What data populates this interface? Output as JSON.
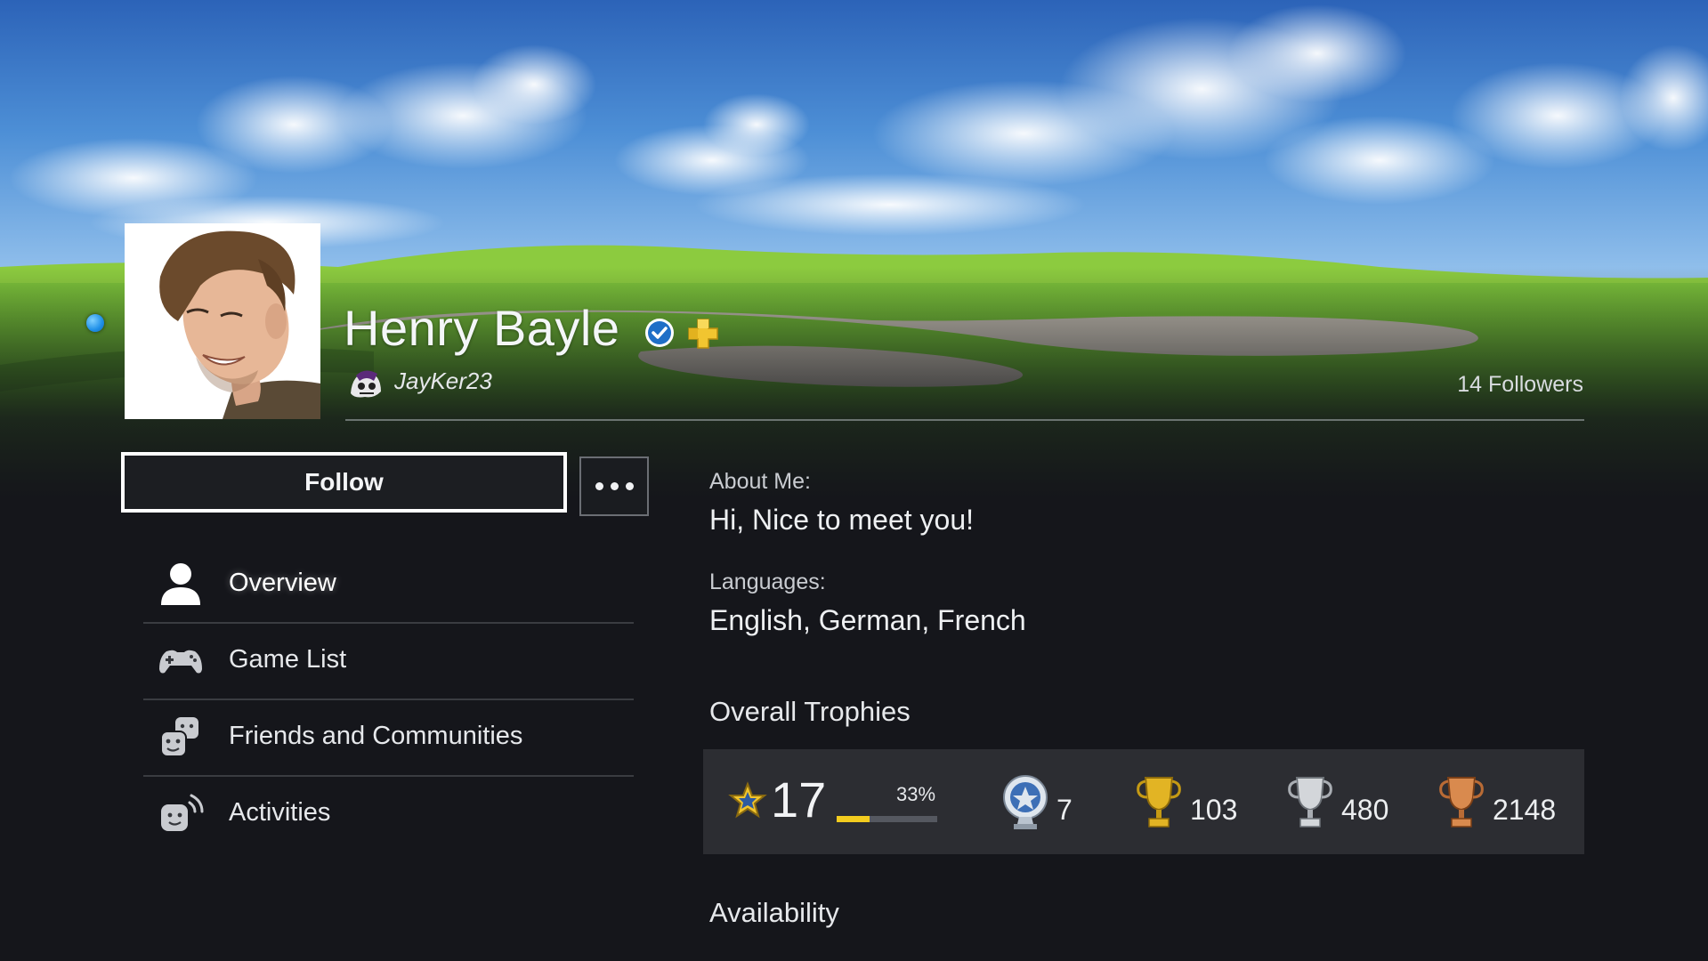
{
  "profile": {
    "display_name": "Henry Bayle",
    "online_id": "JayKer23",
    "followers": "14 Followers",
    "online_status_color": "#1e8fe8"
  },
  "actions": {
    "follow_label": "Follow",
    "more_icon": "ellipsis-icon"
  },
  "nav": {
    "items": [
      {
        "label": "Overview",
        "icon": "person-icon"
      },
      {
        "label": "Game List",
        "icon": "gamepad-icon"
      },
      {
        "label": "Friends and Communities",
        "icon": "friends-icon"
      },
      {
        "label": "Activities",
        "icon": "activity-icon"
      }
    ]
  },
  "about": {
    "label": "About Me:",
    "text": "Hi, Nice to meet you!"
  },
  "languages": {
    "label": "Languages:",
    "text": "English, German, French"
  },
  "trophies": {
    "title": "Overall Trophies",
    "level": "17",
    "progress_label": "33%",
    "progress_fraction": 0.33,
    "platinum": "7",
    "gold": "103",
    "silver": "480",
    "bronze": "2148"
  },
  "availability": {
    "title": "Availability"
  },
  "colors": {
    "accent_progress": "#f3cc1f",
    "background": "#15161b",
    "panel": "#2c2d32"
  }
}
